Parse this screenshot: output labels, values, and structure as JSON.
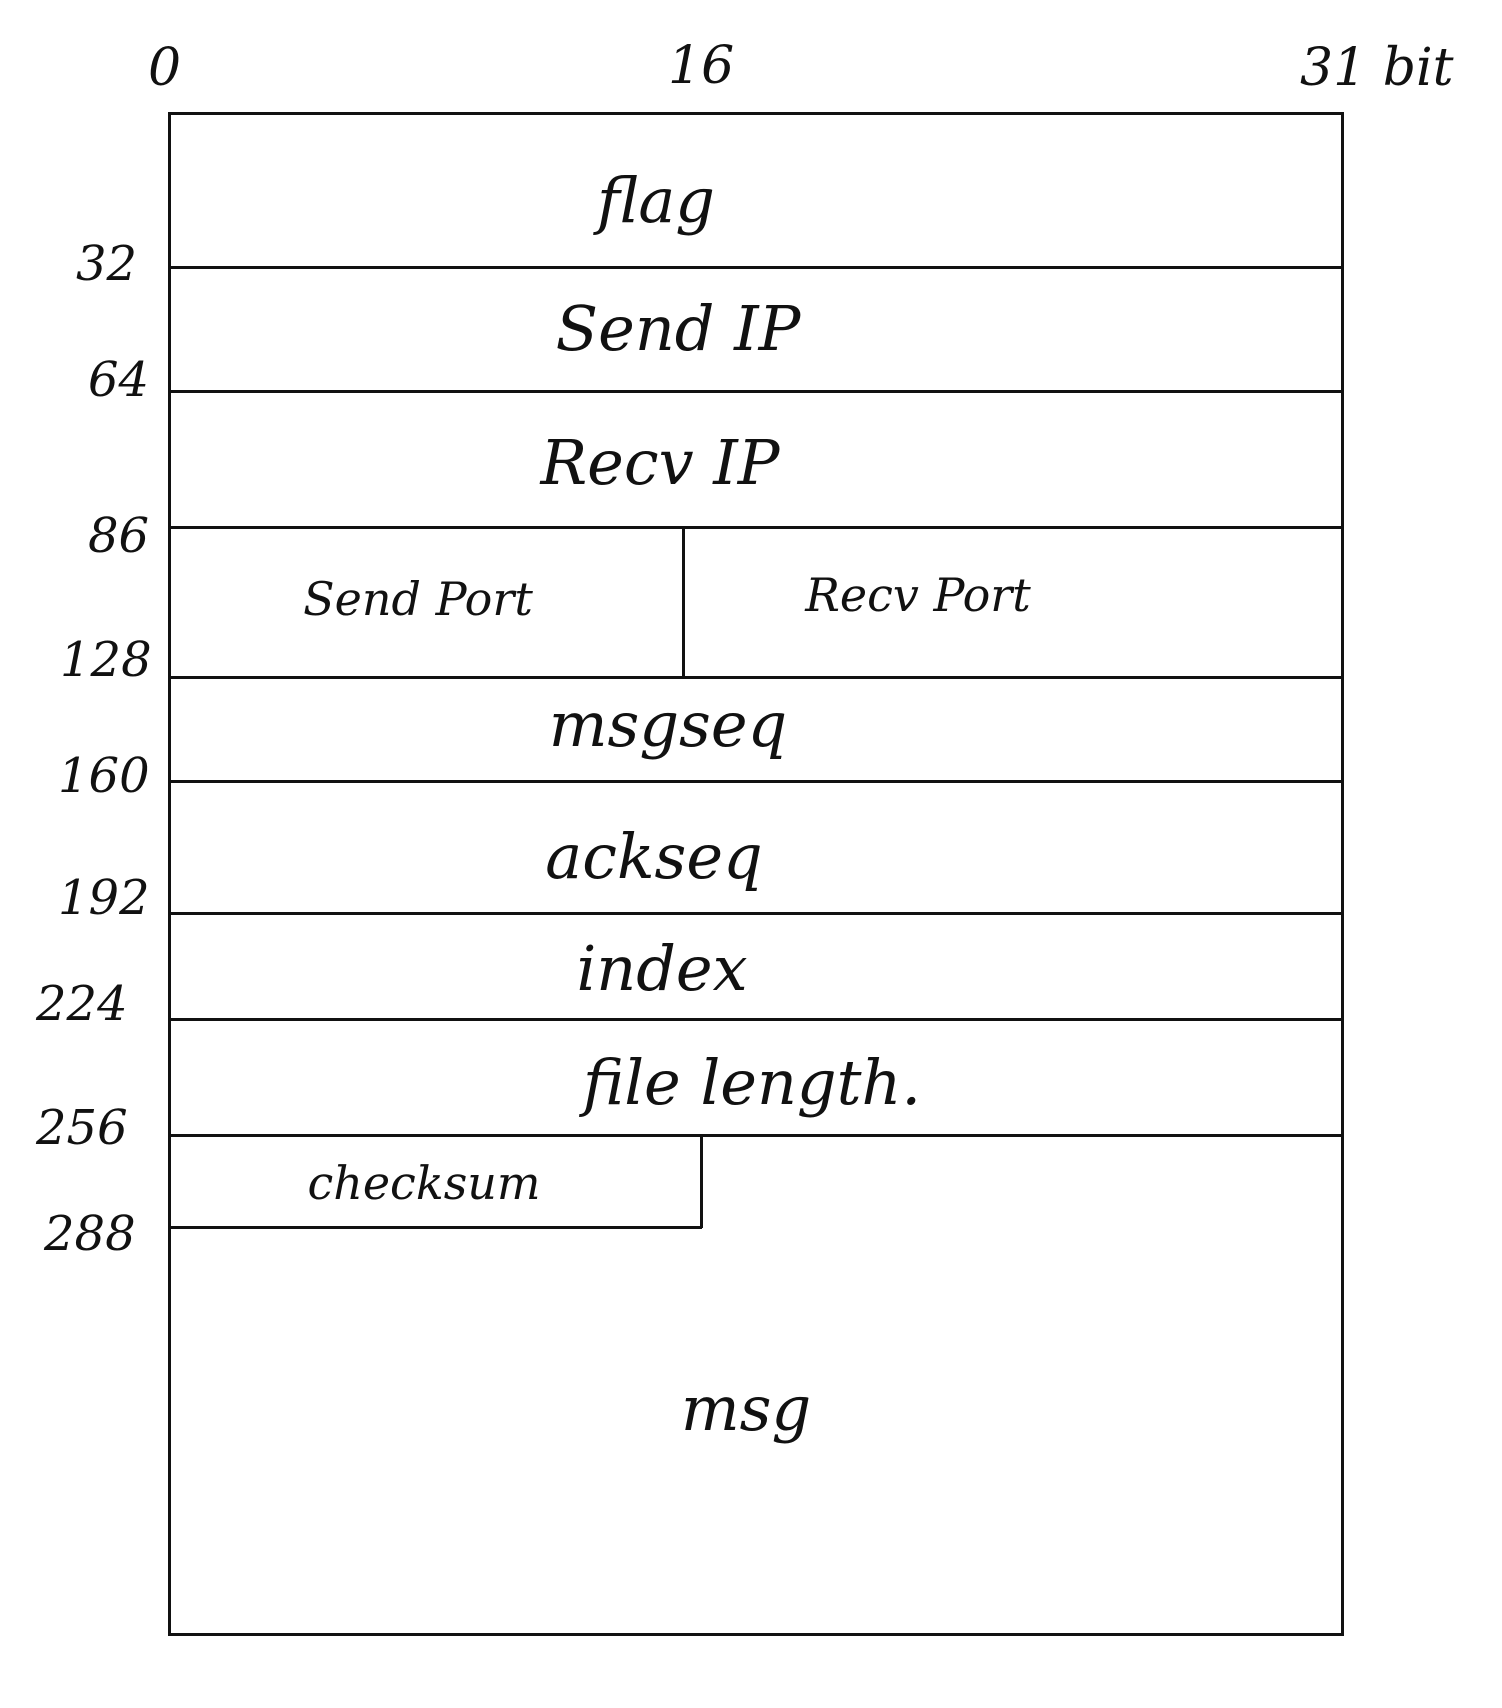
{
  "bit_axis": {
    "start": "0",
    "middle": "16",
    "end": "31 bit"
  },
  "offsets": [
    "32",
    "64",
    "86",
    "128",
    "160",
    "192",
    "224",
    "256",
    "288"
  ],
  "fields": {
    "flag": "flag",
    "send_ip": "Send IP",
    "recv_ip": "Recv IP",
    "send_port": "Send Port",
    "recv_port": "Recv Port",
    "msgseq": "msgseq",
    "ackseq": "ackseq",
    "index": "index",
    "file_length": "file length.",
    "checksum": "checksum",
    "msg": "msg"
  }
}
